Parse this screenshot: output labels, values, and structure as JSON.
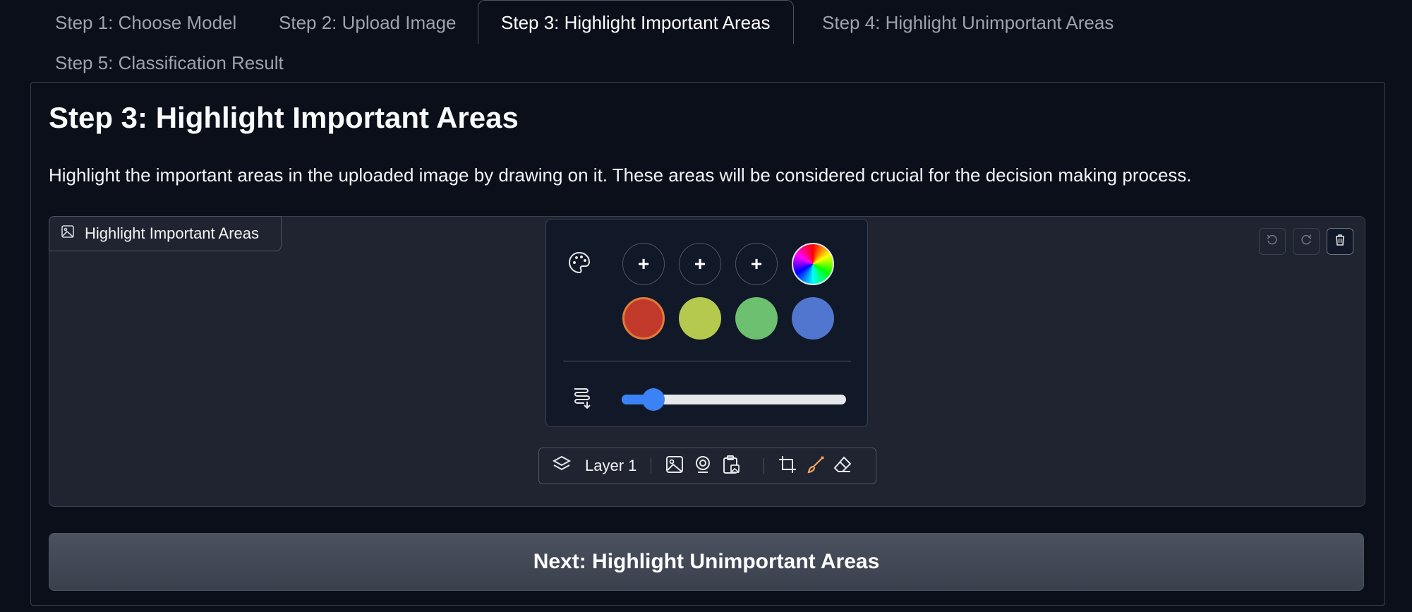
{
  "tabs": [
    {
      "label": "Step 1: Choose Model"
    },
    {
      "label": "Step 2: Upload Image"
    },
    {
      "label": "Step 3: Highlight Important Areas"
    },
    {
      "label": "Step 4: Highlight Unimportant Areas"
    },
    {
      "label": "Step 5: Classification Result"
    }
  ],
  "active_tab": "Step 3: Highlight Important Areas",
  "main": {
    "title": "Step 3: Highlight Important Areas",
    "description": "Highlight the important areas in the uploaded image by drawing on it. These areas will be considered crucial for the decision making process."
  },
  "editor": {
    "label": "Highlight Important Areas",
    "icons": [
      "image-icon",
      "undo-icon",
      "redo-icon",
      "trash-icon"
    ]
  },
  "color_picker": {
    "add_label": "+",
    "colors": [
      "#c0392b",
      "#b5c94e",
      "#6cc070",
      "#5076d0"
    ],
    "selected_color": "#c0392b",
    "selected_ring": "#e07b39",
    "brush_size_fraction": 0.14,
    "icons": [
      "palette-icon",
      "brush-size-icon",
      "color-wheel-icon"
    ]
  },
  "layer_bar": {
    "layer_label": "Layer 1",
    "active_tool_color": "#f5a45d",
    "icons": [
      "layers-icon",
      "upload-image-icon",
      "webcam-icon",
      "clipboard-image-icon",
      "crop-icon",
      "brush-icon",
      "eraser-icon"
    ]
  },
  "next_button": {
    "label": "Next: Highlight Unimportant Areas"
  },
  "colors": {
    "background": "#0b0f19",
    "accent": "#3b82f6"
  }
}
